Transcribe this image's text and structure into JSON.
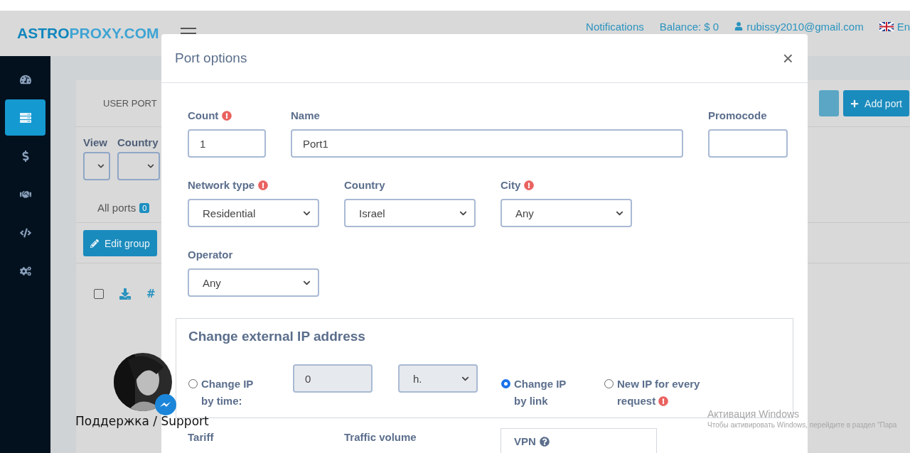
{
  "header": {
    "logo_primary": "ASTRO",
    "logo_secondary": "PROXY.COM",
    "notifications": "Notifications",
    "balance": "Balance: $ 0",
    "email": "rubissy2010@gmail.com",
    "language": "En"
  },
  "sidebar": {
    "items": [
      {
        "selected": false
      },
      {
        "selected": true
      },
      {
        "selected": false
      },
      {
        "selected": false
      },
      {
        "selected": false
      },
      {
        "selected": false
      }
    ]
  },
  "page": {
    "card_title": "USER PORT",
    "filters": [
      {
        "label": "View"
      },
      {
        "label": "Country"
      }
    ],
    "tabs": [
      {
        "label": "All ports",
        "count": "0"
      }
    ],
    "edit_button": "Edit group",
    "add_button": "Add port",
    "table_header": "#",
    "select_all": {
      "checked": false
    }
  },
  "support": {
    "label": "Поддержка / Support"
  },
  "modal": {
    "title": "Port options",
    "close": "×",
    "rows": [
      [
        {
          "label": "Count",
          "required": true,
          "kind": "input",
          "value": "1"
        },
        {
          "label": "Name",
          "required": false,
          "kind": "input",
          "value": "Port1"
        },
        {
          "label": "Promocode",
          "required": false,
          "kind": "input"
        }
      ],
      [
        {
          "label": "Network type",
          "required": true,
          "kind": "select",
          "value": "Residential"
        },
        {
          "label": "Country",
          "required": false,
          "kind": "select",
          "value": "Israel"
        },
        {
          "label": "City",
          "required": true,
          "kind": "select",
          "value": "Any"
        }
      ],
      [
        {
          "label": "Operator",
          "required": false,
          "kind": "select",
          "value": "Any"
        }
      ]
    ],
    "ip_section": {
      "title": "Change external IP address",
      "interval": {
        "value": "0",
        "unit": "h.",
        "disabled": true
      },
      "options": [
        {
          "label": "Change IP by time:",
          "selected": false,
          "required": false
        },
        {
          "label": "Change IP by link",
          "selected": true,
          "required": false
        },
        {
          "label": "New IP for every request",
          "selected": false,
          "required": true
        }
      ]
    },
    "bottom_labels": [
      {
        "label": "Tariff",
        "help": false,
        "boxed": false
      },
      {
        "label": "Traffic volume",
        "help": false,
        "boxed": false
      },
      {
        "label": "VPN",
        "help": true,
        "boxed": true
      }
    ]
  },
  "os_notice": {
    "title": "Активация Windows",
    "text": "Чтобы активировать Windows, перейдите в раздел \"Пара"
  }
}
